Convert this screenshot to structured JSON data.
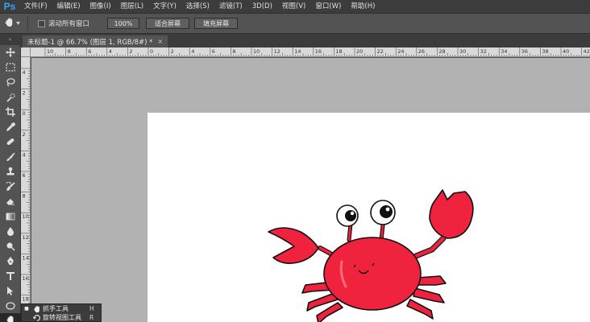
{
  "app": {
    "logo": "Ps"
  },
  "menu": [
    "文件(F)",
    "编辑(E)",
    "图像(I)",
    "图层(L)",
    "文字(Y)",
    "选择(S)",
    "滤镜(T)",
    "3D(D)",
    "视图(V)",
    "窗口(W)",
    "帮助(H)"
  ],
  "options": {
    "current_tool_icon": "hand-icon",
    "scroll_all_windows_label": "滚动所有窗口",
    "scroll_all_windows_checked": false,
    "zoom_button": "100%",
    "fit_screen_button": "适合屏幕",
    "fill_screen_button": "填充屏幕"
  },
  "document": {
    "tab_title": "未标题-1 @ 66.7% (图层 1, RGB/8#) *",
    "close_glyph": "×"
  },
  "rulers": {
    "horizontal": [
      "10",
      "8",
      "6",
      "4",
      "2",
      "0",
      "2",
      "4",
      "6",
      "8",
      "10",
      "12",
      "14",
      "16",
      "18",
      "20",
      "22",
      "24",
      "26",
      "28",
      "30",
      "32",
      "34",
      "36",
      "38",
      "40",
      "42"
    ],
    "vertical": [
      "4",
      "2",
      "0",
      "2",
      "4",
      "6",
      "8",
      "10",
      "12",
      "14",
      "16",
      "18",
      "20"
    ]
  },
  "toolbox": {
    "collapse_glyph": "»",
    "tools": [
      "move-icon",
      "marquee-icon",
      "lasso-icon",
      "quick-select-icon",
      "crop-icon",
      "eyedropper-icon",
      "healing-brush-icon",
      "brush-icon",
      "clone-stamp-icon",
      "history-brush-icon",
      "eraser-icon",
      "gradient-icon",
      "blur-icon",
      "dodge-icon",
      "pen-icon",
      "type-icon",
      "path-select-icon",
      "ellipse-shape-icon",
      "hand-icon"
    ],
    "active_tool": "hand-icon"
  },
  "flyout": [
    {
      "label": "抓手工具",
      "shortcut": "H",
      "icon": "hand-icon",
      "selected": true
    },
    {
      "label": "旋转视图工具",
      "shortcut": "R",
      "icon": "rotate-view-icon",
      "selected": false
    }
  ],
  "colors": {
    "crab_red": "#f0233f",
    "workspace_gray": "#b2b2b2",
    "panel_gray": "#535353",
    "dark_bar": "#3c3c3c"
  }
}
